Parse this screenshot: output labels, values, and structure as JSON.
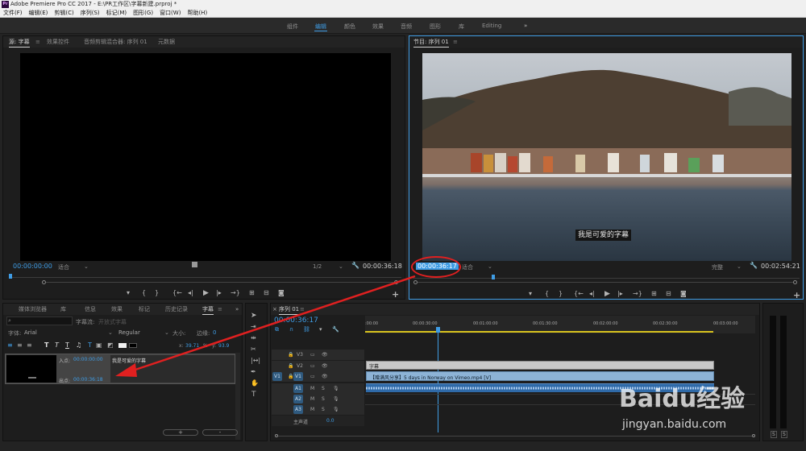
{
  "titlebar": {
    "title": "Adobe Premiere Pro CC 2017 - E:\\PR工作区\\字幕新建.prproj *",
    "logo": "Pr"
  },
  "menubar": {
    "items": [
      "文件(F)",
      "编辑(E)",
      "剪辑(C)",
      "序列(S)",
      "标记(M)",
      "图形(G)",
      "窗口(W)",
      "帮助(H)"
    ]
  },
  "workspaces": {
    "items": [
      "组件",
      "编辑",
      "颜色",
      "效果",
      "音频",
      "图形",
      "库",
      "Editing"
    ],
    "active": "编辑",
    "more": "»"
  },
  "source_monitor": {
    "tabs": [
      "源: 字幕",
      "效果控件",
      "音频剪辑混合器: 序列 01",
      "元数据"
    ],
    "timecode_in": "00:00:00:00",
    "fit": "适合",
    "resolution": "1/2",
    "duration": "00:00:36:18"
  },
  "program_monitor": {
    "tab": "节目: 序列 01",
    "subtitle": "我是可爱的字幕",
    "timecode": "00:00:36:17",
    "fit": "适合",
    "quality": "完整",
    "duration": "00:02:54:21"
  },
  "captions_panel": {
    "tabs": [
      "媒体浏览器",
      "库",
      "信息",
      "效果",
      "标记",
      "历史记录",
      "字幕"
    ],
    "stream_label": "字幕流:",
    "stream_value": "开放式字幕",
    "font_label": "字体:",
    "font_value": "Arial",
    "style_value": "Regular",
    "size_label": "大小:",
    "outline_label": "边缘:",
    "outline_value": "0",
    "x_label": "x:",
    "x_value": "39.71",
    "y_label": "y:",
    "y_value": "93.9",
    "percent": "%",
    "in_label": "入点:",
    "in_value": "00:00:00:00",
    "out_label": "出点:",
    "out_value": "00:00:36:18",
    "caption_text": "我是可爱的字幕",
    "add": "+",
    "remove": "-"
  },
  "timeline": {
    "tab": "序列 01",
    "timecode": "00:00:36:17",
    "ruler": [
      ":00:00",
      "00:00:30:00",
      "00:01:00:00",
      "00:01:30:00",
      "00:02:00:00",
      "00:02:30:00",
      "00:03:00:00"
    ],
    "tracks": [
      {
        "id": "V3",
        "kind": "video"
      },
      {
        "id": "V2",
        "kind": "video"
      },
      {
        "id": "V1",
        "kind": "video",
        "source": "V1"
      },
      {
        "id": "A1",
        "kind": "audio",
        "source": "A1"
      },
      {
        "id": "A2",
        "kind": "audio"
      },
      {
        "id": "A3",
        "kind": "audio"
      }
    ],
    "master_label": "主声道",
    "master_value": "0.0",
    "caption_clip": "字幕",
    "video_clip": "【赠满风分享】5 days in Norway on Vimeo.mp4 [V]",
    "mute": "M",
    "solo": "S"
  },
  "meter": {
    "solo_l": "S",
    "solo_r": "S"
  },
  "watermark": {
    "brand": "Baidu经验",
    "url": "jingyan.baidu.com"
  },
  "colors": {
    "accent": "#3f9ce4",
    "annotation": "#e02020"
  }
}
